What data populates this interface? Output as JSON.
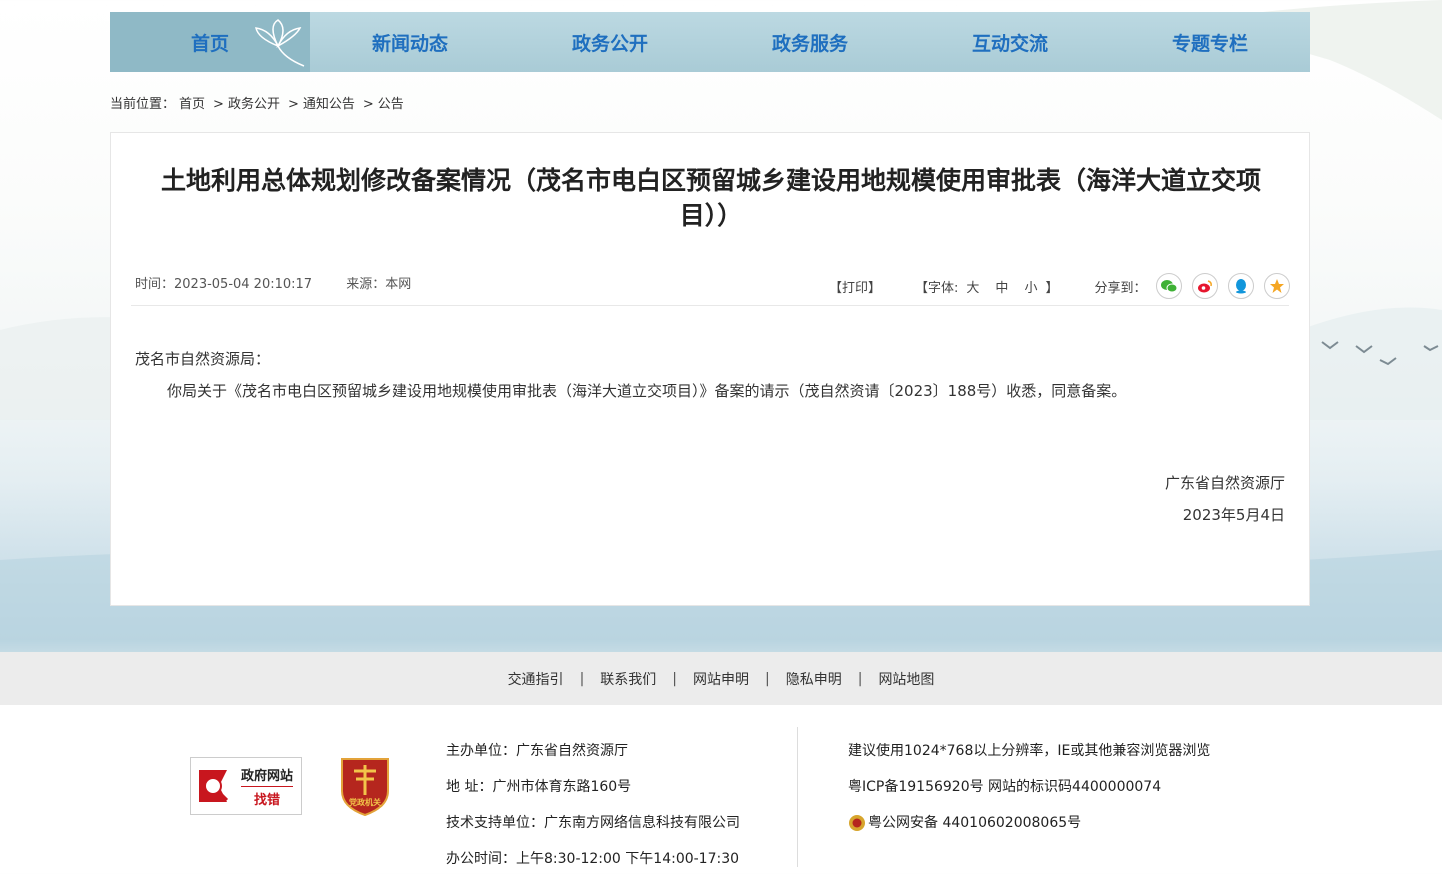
{
  "nav": {
    "items": [
      {
        "label": "首页",
        "active": true
      },
      {
        "label": "新闻动态"
      },
      {
        "label": "政务公开"
      },
      {
        "label": "政务服务"
      },
      {
        "label": "互动交流"
      },
      {
        "label": "专题专栏"
      }
    ]
  },
  "breadcrumb": {
    "prefix": "当前位置：",
    "items": [
      "首页",
      "政务公开",
      "通知公告",
      "公告"
    ],
    "separator": ">"
  },
  "article": {
    "title_line1": "土地利用总体规划修改备案情况（茂名市电白区预留城乡建设用地规模使用审批表（海洋大道立交项",
    "title_line2": "目））",
    "time": "时间：2023-05-04 20:10:17",
    "source": "来源：本网",
    "print": "【打印】",
    "font_prefix": "【字体:",
    "font_large": "大",
    "font_medium": "中",
    "font_small": "小",
    "font_suffix": "】",
    "share_label": "分享到：",
    "salutation": "茂名市自然资源局：",
    "paragraph": "你局关于《茂名市电白区预留城乡建设用地规模使用审批表（海洋大道立交项目）》备案的请示（茂自然资请〔2023〕188号）收悉，同意备案。",
    "signer": "广东省自然资源厅",
    "date": "2023年5月4日"
  },
  "footer_links": [
    "交通指引",
    "联系我们",
    "网站申明",
    "隐私申明",
    "网站地图"
  ],
  "footer": {
    "badge1_line1": "政府网站",
    "badge1_line2": "找错",
    "badge2_text": "党政机关",
    "host": "主办单位：广东省自然资源厅",
    "address": "地  址：广州市体育东路160号",
    "support": "技术支持单位：广东南方网络信息科技有限公司",
    "hours": "办公时间：上午8:30-12:00  下午14:00-17:30",
    "browser": "建议使用1024*768以上分辨率，IE或其他兼容浏览器浏览",
    "icp": "粤ICP备19156920号 网站的标识码4400000074",
    "police": "粤公网安备 44010602008065号"
  },
  "colors": {
    "nav_bg": "#a9cbd6",
    "nav_text": "#1f6fbf",
    "wechat": "#3eb135",
    "weibo": "#e6162d",
    "qq": "#1296db",
    "favorite": "#f5a623"
  }
}
